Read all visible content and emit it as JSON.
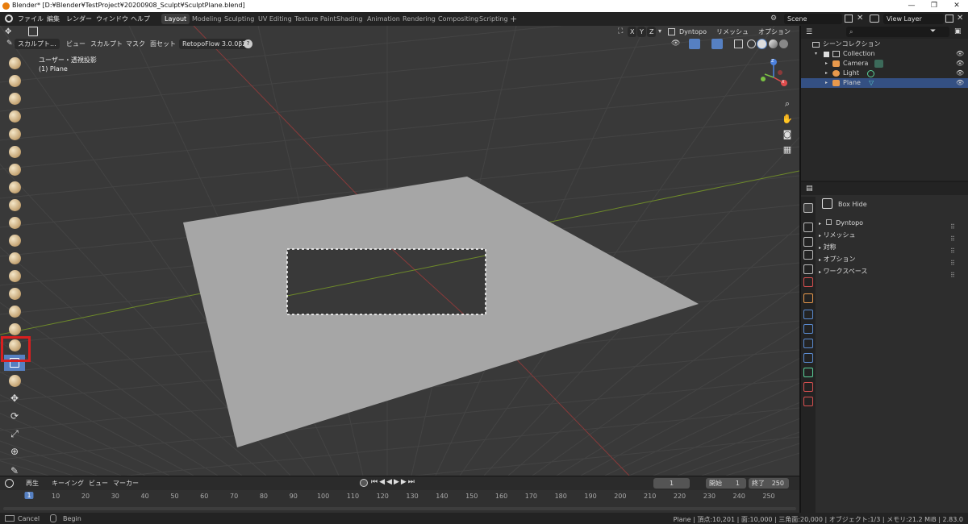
{
  "window": {
    "title": "Blender* [D:¥Blender¥TestProject¥20200908_Sculpt¥SculptPlane.blend]",
    "min": "—",
    "max": "❐",
    "close": "✕"
  },
  "topbar": {
    "menus": [
      "ファイル",
      "編集",
      "レンダー",
      "ウィンドウ",
      "ヘルプ"
    ],
    "workspaces": [
      "Layout",
      "Modeling",
      "Sculpting",
      "UV Editing",
      "Texture Paint",
      "Shading",
      "Animation",
      "Rendering",
      "Compositing",
      "Scripting"
    ],
    "add_tab": "+",
    "scene": "Scene",
    "view_layer": "View Layer"
  },
  "viewport_header": {
    "mode": "スカルプト...",
    "menus": [
      "ビュー",
      "スカルプト",
      "マスク",
      "面セット"
    ],
    "addon": "RetopoFlow 3.0.0β2",
    "help": "?",
    "xyz": [
      "X",
      "Y",
      "Z"
    ],
    "dyntopo": "Dyntopo",
    "remesh": "リメッシュ",
    "options": "オプション"
  },
  "overlay": {
    "view_name": "ユーザー・透視投影",
    "object": "(1) Plane"
  },
  "gizmo": {
    "x": "X",
    "y": "Y",
    "z": "Z"
  },
  "toolbar": {
    "tools": [
      "draw-brush",
      "draw-sharp-brush",
      "clay-brush",
      "clay-strips-brush",
      "clay-thumb-brush",
      "layer-brush",
      "inflate-brush",
      "blob-brush",
      "crease-brush",
      "smooth-brush",
      "flatten-brush",
      "fill-brush",
      "scrape-brush",
      "multiplane-scrape-brush",
      "pinch-brush",
      "grab-brush",
      "elastic-deform-brush",
      "snake-hook-brush",
      "thumb-brush",
      "pose-brush",
      "nudge-brush",
      "rotate-brush",
      "slide-relax-brush",
      "cloth-brush",
      "simplify-brush",
      "mask-brush",
      "draw-face-sets-brush",
      "box-mask",
      "box-hide",
      "box-face-set",
      "mesh-filter",
      "cloth-filter",
      "color-filter",
      "edit-face-set",
      "mask-by-color",
      "move",
      "rotate",
      "scale",
      "transform",
      "annotate"
    ],
    "active": "box-hide"
  },
  "timeline": {
    "menus": [
      "再生",
      "キーイング",
      "ビュー",
      "マーカー"
    ],
    "current_frame": "1",
    "start_label": "開始",
    "start": "1",
    "end_label": "終了",
    "end": "250",
    "ticks": [
      "1",
      "10",
      "20",
      "30",
      "40",
      "50",
      "60",
      "70",
      "80",
      "90",
      "100",
      "110",
      "120",
      "130",
      "140",
      "150",
      "160",
      "170",
      "180",
      "190",
      "200",
      "210",
      "220",
      "230",
      "240",
      "250"
    ]
  },
  "status": {
    "left": [
      "Cancel",
      "Begin"
    ],
    "right": "Plane | 頂点:10,201 | 面:10,000 | 三角面:20,000 | オブジェクト:1/3 | メモリ:21.2 MiB | 2.83.0"
  },
  "outliner": {
    "root": "シーンコレクション",
    "collection": "Collection",
    "items": [
      "Camera",
      "Light",
      "Plane"
    ],
    "selected": "Plane"
  },
  "properties": {
    "tool_name": "Box Hide",
    "panels": [
      "Dyntopo",
      "リメッシュ",
      "対称",
      "オプション",
      "ワークスペース"
    ]
  },
  "colors": {
    "accent": "#5680c2",
    "highlight": "#e02020",
    "x_axis": "#8a3a3a",
    "y_axis": "#6e8a2a",
    "plane": "#a6a6a6"
  }
}
